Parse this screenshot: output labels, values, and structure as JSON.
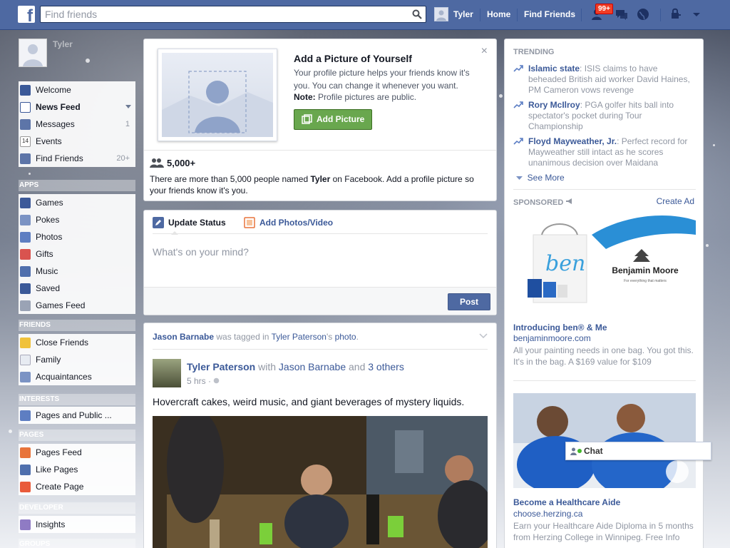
{
  "topbar": {
    "logo": "f",
    "search_placeholder": "Find friends",
    "user": "Tyler",
    "home": "Home",
    "find_friends": "Find Friends",
    "notif_badge": "99+"
  },
  "leftnav": {
    "profile_name": "Tyler",
    "main": [
      {
        "label": "Welcome",
        "icon": "fb-square-icon"
      },
      {
        "label": "News Feed",
        "icon": "news-feed-icon"
      },
      {
        "label": "Messages",
        "icon": "messages-icon",
        "count": "1"
      },
      {
        "label": "Events",
        "icon": "calendar-icon"
      },
      {
        "label": "Find Friends",
        "icon": "find-friends-icon",
        "count": "20+"
      }
    ],
    "apps_heading": "APPS",
    "apps": [
      {
        "label": "Games"
      },
      {
        "label": "Pokes"
      },
      {
        "label": "Photos"
      },
      {
        "label": "Gifts"
      },
      {
        "label": "Music"
      },
      {
        "label": "Saved"
      },
      {
        "label": "Games Feed"
      }
    ],
    "friends_heading": "FRIENDS",
    "friends": [
      {
        "label": "Close Friends"
      },
      {
        "label": "Family"
      },
      {
        "label": "Acquaintances"
      }
    ],
    "interests_heading": "INTERESTS",
    "interests": [
      {
        "label": "Pages and Public ..."
      }
    ],
    "pages_heading": "PAGES",
    "pages": [
      {
        "label": "Pages Feed"
      },
      {
        "label": "Like Pages"
      },
      {
        "label": "Create Page"
      }
    ],
    "developer_heading": "DEVELOPER",
    "developer": [
      {
        "label": "Insights"
      }
    ],
    "groups_heading": "GROUPS"
  },
  "profile_prompt": {
    "title": "Add a Picture of Yourself",
    "desc": "Your profile picture helps your friends know it's you. You can change it whenever you want.",
    "note_label": "Note:",
    "note_text": "Profile pictures are public.",
    "button": "Add Picture",
    "count": "5,000+",
    "footer_pre": "There are more than 5,000 people named ",
    "footer_name": "Tyler",
    "footer_post": " on Facebook. Add a profile picture so your friends know it's you.",
    "close": "×"
  },
  "composer": {
    "tab_status": "Update Status",
    "tab_photos": "Add Photos/Video",
    "placeholder": "What's on your mind?",
    "post": "Post"
  },
  "story": {
    "tagger": "Jason Barnabe",
    "was_tagged_in": " was tagged in ",
    "owner": "Tyler Paterson",
    "owner_suffix": "'s ",
    "photo": "photo",
    "period": ".",
    "author": "Tyler Paterson",
    "with": " with ",
    "with_name": "Jason Barnabe",
    "and": " and ",
    "others": "3 others",
    "time": "5 hrs ·",
    "text": "Hovercraft cakes, weird music, and giant beverages of mystery liquids."
  },
  "right": {
    "trending_heading": "TRENDING",
    "trends": [
      {
        "topic": "Islamic state",
        "text": ": ISIS claims to have beheaded British aid worker David Haines, PM Cameron vows revenge"
      },
      {
        "topic": "Rory McIlroy",
        "text": ": PGA golfer hits ball into spectator's pocket during Tour Championship"
      },
      {
        "topic": "Floyd Mayweather, Jr.",
        "text": ": Perfect record for Mayweather still intact as he scores unanimous decision over Maidana"
      }
    ],
    "see_more": "See More",
    "sponsored_heading": "SPONSORED",
    "create_ad": "Create Ad",
    "ad1": {
      "brand": "Benjamin Moore",
      "tagline": "For everything that matters",
      "script": "ben",
      "title": "Introducing ben® & Me",
      "url": "benjaminmoore.com",
      "body": "All your painting needs in one bag. You got this. It's in the bag. A $169 value for $109"
    },
    "ad2": {
      "title": "Become a Healthcare Aide",
      "url": "choose.herzing.ca",
      "body": "Earn your Healthcare Aide Diploma in 5 months from Herzing College in Winnipeg. Free Info"
    }
  },
  "chat": {
    "label": "Chat"
  }
}
